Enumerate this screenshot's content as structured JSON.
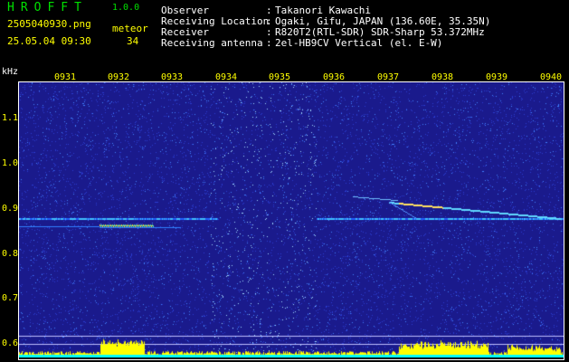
{
  "header": {
    "app_title": "HROFFT",
    "app_version": "1.0.0",
    "filename": "2505040930.png",
    "meteor_label": "meteor",
    "datetime": "25.05.04 09:30",
    "meteor_count": "34"
  },
  "info": [
    {
      "key": "Observer",
      "sep": ":",
      "value": "Takanori Kawachi"
    },
    {
      "key": "Receiving Location",
      "sep": ":",
      "value": "Ogaki, Gifu, JAPAN (136.60E, 35.35N)"
    },
    {
      "key": "Receiver",
      "sep": ":",
      "value": "R820T2(RTL-SDR) SDR-Sharp 53.372MHz"
    },
    {
      "key": "Receiving antenna",
      "sep": ":",
      "value": "2el-HB9CV Vertical (el. E-W)"
    }
  ],
  "spectrogram": {
    "unit_label": "kHz",
    "x_ticks": [
      "0931",
      "0932",
      "0933",
      "0934",
      "0935",
      "0936",
      "0937",
      "0938",
      "0939",
      "0940"
    ],
    "y_ticks": [
      "1.1",
      "1.0",
      "0.9",
      "0.8",
      "0.7",
      "0.6"
    ],
    "colors": {
      "background": "#1a1a8c",
      "text_green": "#00e000",
      "text_yellow": "#ffff00",
      "signal": "#40c0ff",
      "noise_floor": "#ffff00"
    }
  }
}
